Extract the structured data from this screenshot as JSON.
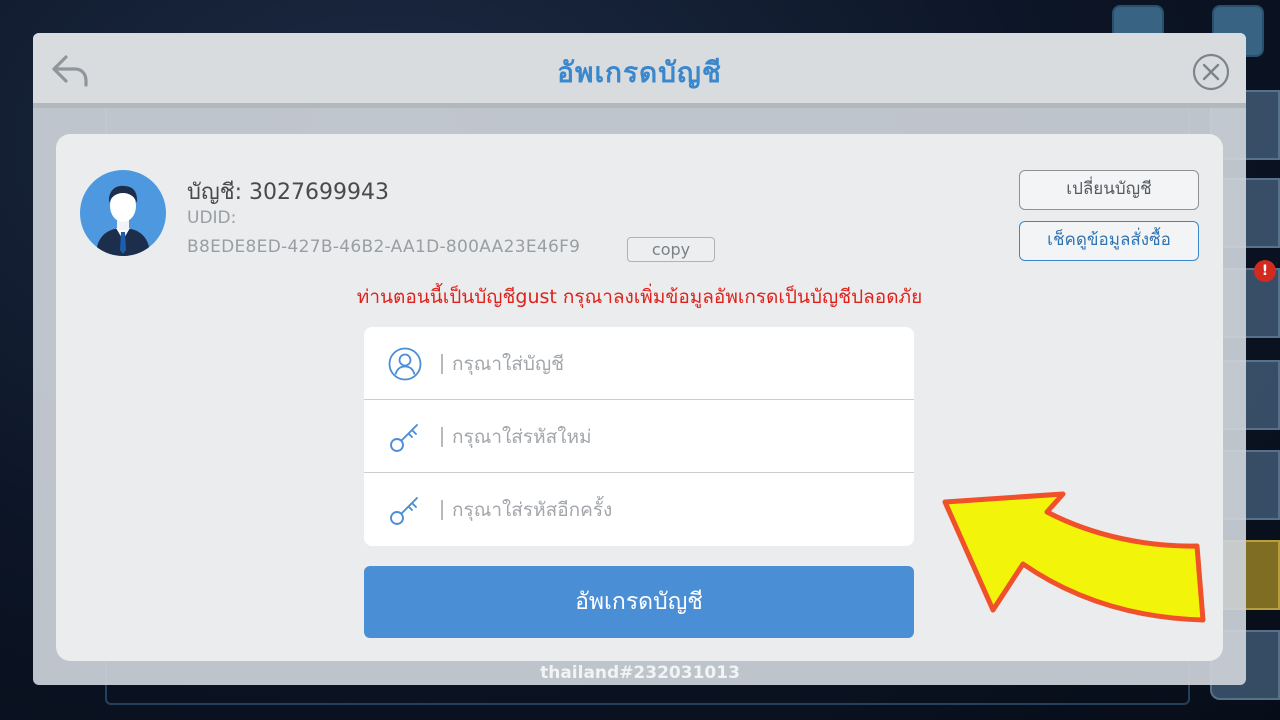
{
  "background": {
    "side_items": 7
  },
  "header": {
    "title": "อัพเกรดบัญชี",
    "back_icon": "back-arrow-icon",
    "close_icon": "close-circle-icon"
  },
  "account": {
    "label": "บัญชี: 3027699943",
    "udid_label": "UDID:",
    "udid_value": "B8EDE8ED-427B-46B2-AA1D-800AA23E46F9",
    "copy_label": "copy",
    "avatar_icon": "user-avatar-icon"
  },
  "actions": {
    "switch_account": "เปลี่ยนบัญชี",
    "check_purchase": "เช็คดูข้อมูลสั่งซื้อ"
  },
  "warning": "ท่านตอนนี้เป็นบัญชีgust กรุณาลงเพิ่มข้อมูลอัพเกรดเป็นบัญชีปลอดภัย",
  "form": {
    "account_placeholder": "กรุณาใส่บัญชี",
    "password_placeholder": "กรุณาใส่รหัสใหม่",
    "confirm_placeholder": "กรุณาใส่รหัสอีกครั้ง",
    "account_icon": "user-circle-icon",
    "password_icon": "key-icon"
  },
  "submit_label": "อัพเกรดบัญชี",
  "server": "thailand#232031013",
  "colors": {
    "title": "#3a87cc",
    "warning": "#e0221b",
    "button": "#4a8fd6",
    "arrow_fill": "#f2f50a",
    "arrow_border": "#f0502a"
  }
}
